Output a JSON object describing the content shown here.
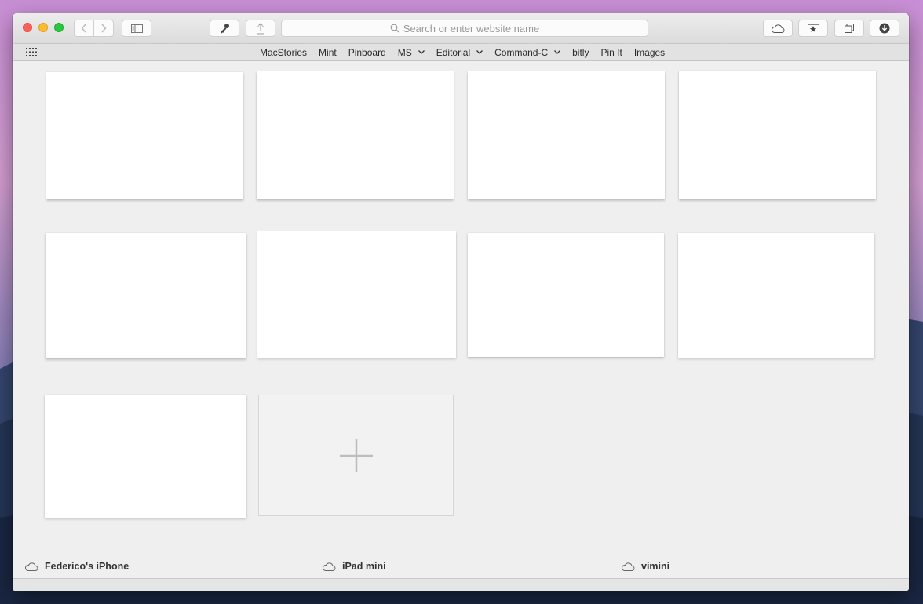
{
  "toolbar": {
    "back_icon": "chevron-left-icon",
    "forward_icon": "chevron-right-icon",
    "sidebar_icon": "sidebar-icon",
    "key_icon": "key-icon",
    "share_icon": "share-icon",
    "search_placeholder": "Search or enter website name",
    "icloud_tabs_icon": "cloud-icon",
    "bookmark_icon": "star-bookmark-icon",
    "tabs_icon": "tabs-icon",
    "downloads_icon": "download-icon"
  },
  "favorites": [
    {
      "label": "MacStories",
      "menu": false
    },
    {
      "label": "Mint",
      "menu": false
    },
    {
      "label": "Pinboard",
      "menu": false
    },
    {
      "label": "MS",
      "menu": true
    },
    {
      "label": "Editorial",
      "menu": true
    },
    {
      "label": "Command-C",
      "menu": true
    },
    {
      "label": "bitly",
      "menu": false
    },
    {
      "label": "Pin It",
      "menu": false
    },
    {
      "label": "Images",
      "menu": false
    }
  ],
  "top_sites": {
    "tile_count": 9,
    "add_symbol": "+"
  },
  "icloud_devices": [
    {
      "name": "Federico's iPhone"
    },
    {
      "name": "iPad mini"
    },
    {
      "name": "vimini"
    }
  ],
  "colors": {
    "close": "#fc5f57",
    "minimize": "#fdbc2e",
    "maximize": "#28c840",
    "content_bg": "#efefef"
  }
}
